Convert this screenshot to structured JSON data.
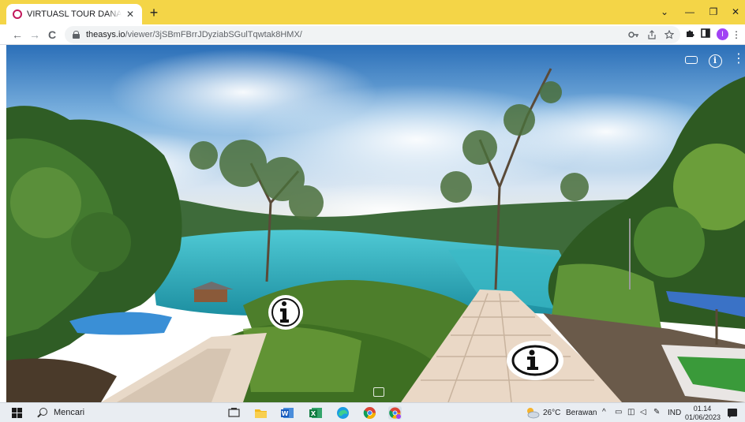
{
  "browser": {
    "tab": {
      "title": "VIRTUASL TOUR DANAU NAPABALE",
      "close_glyph": "✕",
      "favicon": "circle-favicon-icon"
    },
    "new_tab_glyph": "+",
    "window_controls": {
      "dropdown": "⌄",
      "minimize": "—",
      "restore": "❐",
      "close": "✕"
    },
    "nav": {
      "back": "←",
      "forward": "→",
      "reload": "C"
    },
    "address": {
      "host": "theasys.io",
      "path": "/viewer/3jSBmFBrrJDyziabSGulTqwtak8HMX/"
    },
    "omnibox_icons": [
      "key-icon",
      "share-icon",
      "star-icon"
    ],
    "toolbar_icons": [
      "extensions-icon",
      "sidepanel-icon"
    ],
    "profile_initial": "I",
    "menu_glyph": "⋮"
  },
  "viewer": {
    "controls": [
      "vr-icon",
      "info-icon",
      "more-icon"
    ],
    "more_glyph": "⋮",
    "info_glyph": "i",
    "hotspots": [
      "info-hotspot",
      "info-hotspot"
    ]
  },
  "taskbar": {
    "search_label": "Mencari",
    "apps": [
      "task-view-icon",
      "file-explorer-icon",
      "word-icon",
      "excel-icon",
      "edge-icon",
      "chrome-icon",
      "chrome-profile-icon"
    ],
    "weather": {
      "temp": "26°C",
      "condition": "Berawan"
    },
    "tray_language": "IND",
    "time": "01.14",
    "date": "01/06/2023"
  },
  "colors": {
    "tab_strip": "#f4d547",
    "profile": "#a142f4",
    "taskbar": "#e9edf2"
  }
}
